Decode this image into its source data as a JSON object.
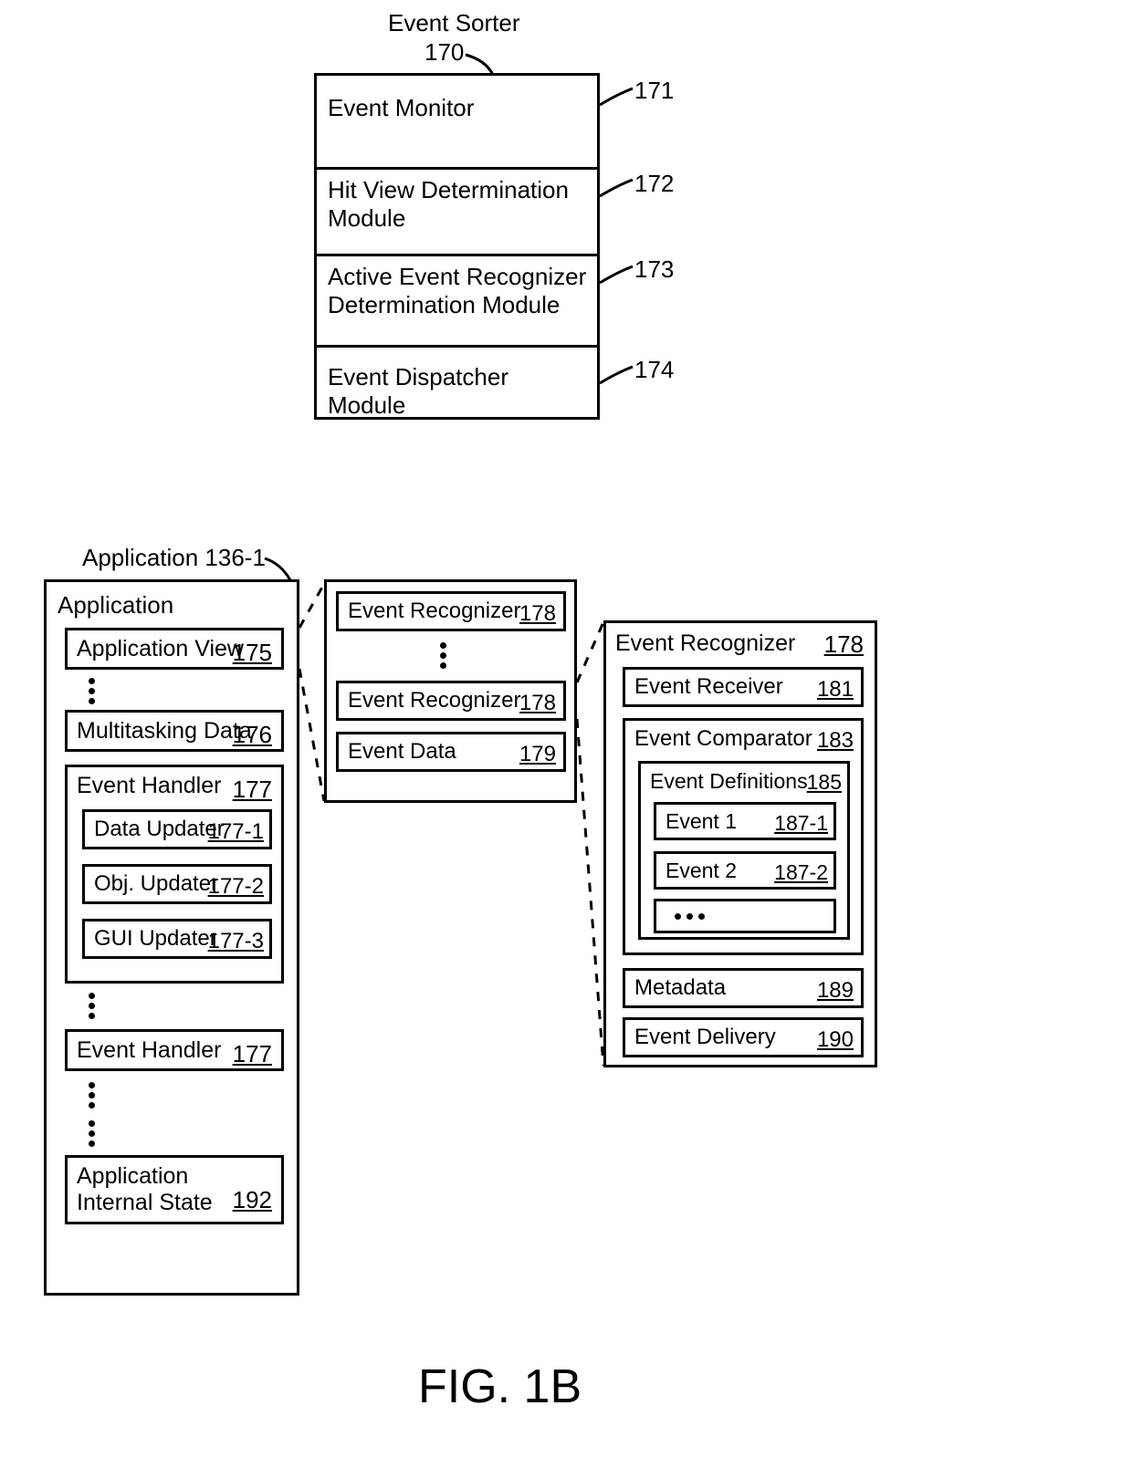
{
  "figure_label": "FIG. 1B",
  "event_sorter": {
    "title": "Event Sorter",
    "ref": "170",
    "rows": [
      {
        "label": "Event Monitor",
        "ref": "171"
      },
      {
        "label": "Hit View Determination Module",
        "ref": "172"
      },
      {
        "label": "Active Event Recognizer Determination Module",
        "ref": "173"
      },
      {
        "label": "Event Dispatcher Module",
        "ref": "174"
      }
    ]
  },
  "application": {
    "callout": "Application 136-1",
    "title": "Application",
    "app_view": {
      "label": "Application View",
      "ref": "175"
    },
    "multitasking": {
      "label": "Multitasking Data",
      "ref": "176"
    },
    "event_handler": {
      "label": "Event Handler",
      "ref": "177"
    },
    "data_updater": {
      "label": "Data Updater",
      "ref": "177-1"
    },
    "obj_updater": {
      "label": "Obj. Updater",
      "ref": "177-2"
    },
    "gui_updater": {
      "label": "GUI Updater",
      "ref": "177-3"
    },
    "event_handler2": {
      "label": "Event Handler",
      "ref": "177"
    },
    "app_internal_state": {
      "label": "Application Internal State",
      "ref": "192"
    }
  },
  "mid": {
    "er1": {
      "label": "Event Recognizer",
      "ref": "178"
    },
    "er2": {
      "label": "Event Recognizer",
      "ref": "178"
    },
    "ed": {
      "label": "Event Data",
      "ref": "179"
    }
  },
  "right": {
    "er": {
      "label": "Event Recognizer",
      "ref": "178"
    },
    "receiver": {
      "label": "Event Receiver",
      "ref": "181"
    },
    "comparator": {
      "label": "Event Comparator",
      "ref": "183"
    },
    "definitions": {
      "label": "Event Definitions",
      "ref": "185"
    },
    "event1": {
      "label": "Event 1",
      "ref": "187-1"
    },
    "event2": {
      "label": "Event 2",
      "ref": "187-2"
    },
    "metadata": {
      "label": "Metadata",
      "ref": "189"
    },
    "delivery": {
      "label": "Event Delivery",
      "ref": "190"
    }
  }
}
